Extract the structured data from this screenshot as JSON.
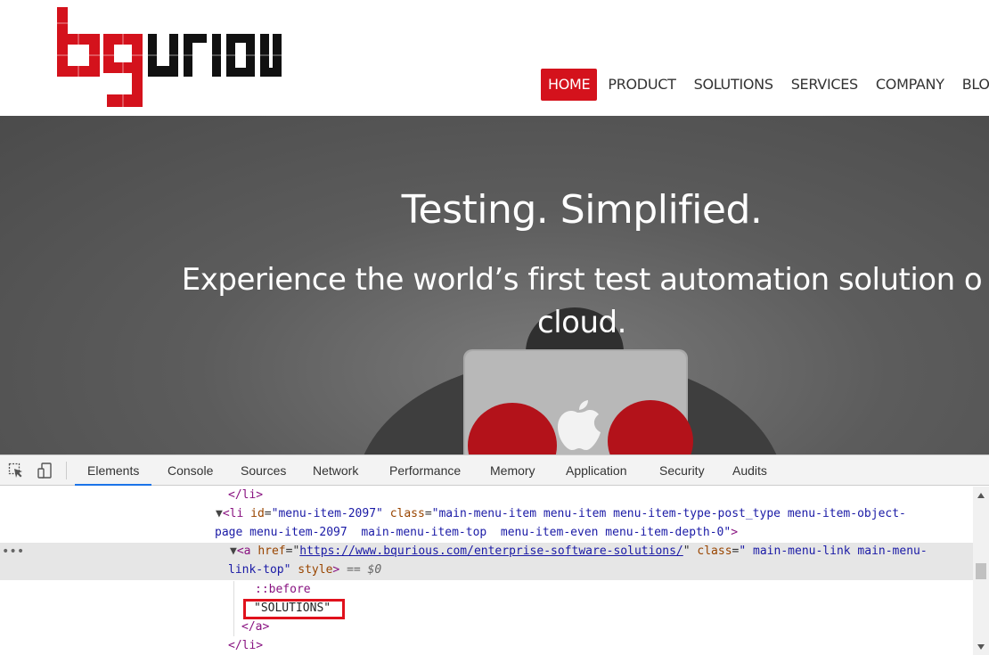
{
  "header": {
    "logo_text": "bqurious",
    "nav": [
      {
        "label": "HOME",
        "active": true
      },
      {
        "label": "PRODUCT",
        "active": false
      },
      {
        "label": "SOLUTIONS",
        "active": false
      },
      {
        "label": "SERVICES",
        "active": false
      },
      {
        "label": "COMPANY",
        "active": false
      },
      {
        "label": "BLOG",
        "active": false
      }
    ]
  },
  "hero": {
    "title": "Testing. Simplified.",
    "subtitle_line1": "Experience the world’s first test automation solution o",
    "subtitle_line2": "cloud."
  },
  "devtools": {
    "tabs": [
      "Elements",
      "Console",
      "Sources",
      "Network",
      "Performance",
      "Memory",
      "Application",
      "Security",
      "Audits"
    ],
    "active_tab": "Elements",
    "code": {
      "close_li_1": "</li>",
      "li_tag": "<li",
      "li_id_attr": "id",
      "li_id_val": "\"menu-item-2097\"",
      "li_class_attr": "class",
      "li_class_val_1": "\"main-menu-item menu-item menu-item-type-post_type menu-item-object-",
      "li_class_val_2": "page menu-item-2097  main-menu-item-top  menu-item-even menu-item-depth-0\"",
      "li_end": ">",
      "a_tag": "<a",
      "a_href_attr": "href",
      "a_href_val": "https://www.bqurious.com/enterprise-software-solutions/",
      "a_class_attr": "class",
      "a_class_val_1": "\" main-menu-link main-menu-",
      "a_class_val_2": "link-top\"",
      "a_style_attr": "style",
      "a_eq": "== $0",
      "pseudo_before": "::before",
      "text_node": "\"SOLUTIONS\"",
      "close_a": "</a>",
      "close_li_2": "</li>"
    }
  },
  "colors": {
    "brand_red": "#d4121c",
    "highlight_red": "#e0111c",
    "devtools_accent": "#1a73e8"
  }
}
